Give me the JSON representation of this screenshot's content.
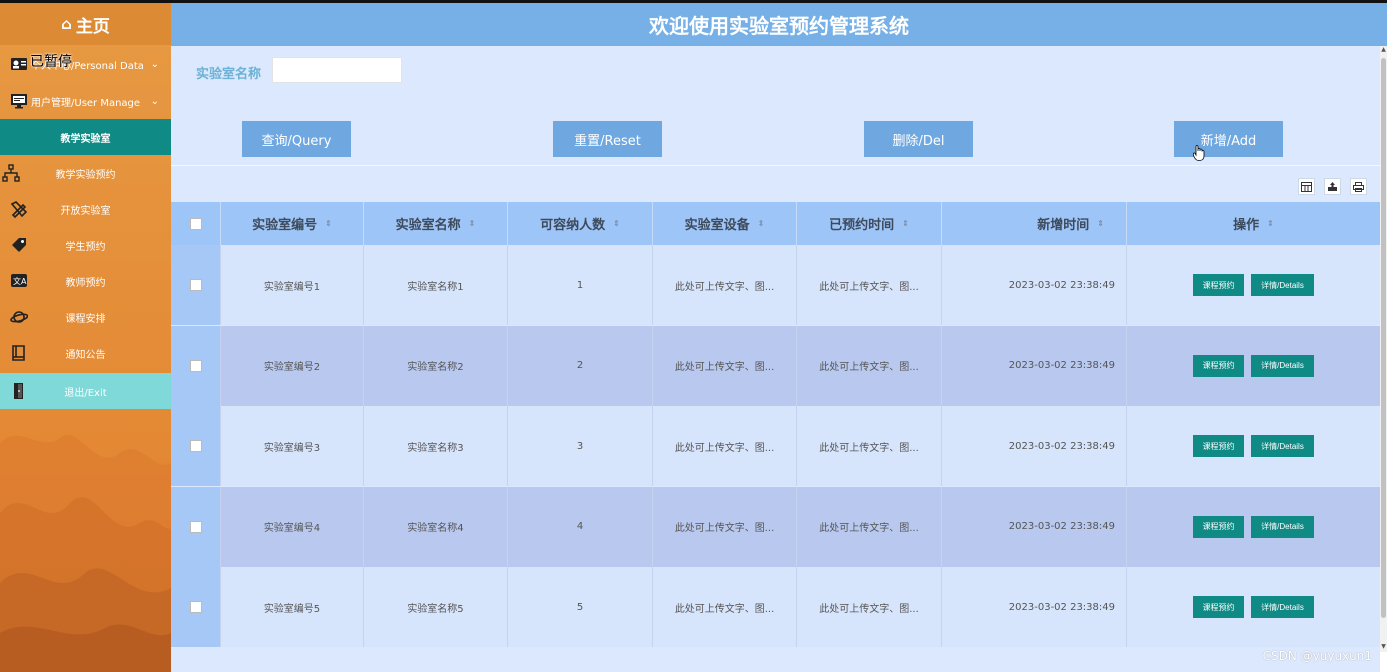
{
  "sidebar": {
    "home_label": "主页",
    "paused_overlay": "已暂停",
    "items": [
      {
        "label": "个人中心/Personal Data",
        "icon": "id-card-icon",
        "has_chevron": true
      },
      {
        "label": "用户管理/User Manage",
        "icon": "monitor-icon",
        "has_chevron": true
      },
      {
        "label": "教学实验室",
        "icon": "",
        "active": true
      },
      {
        "label": "教学实验预约",
        "icon": "sitemap-icon"
      },
      {
        "label": "开放实验室",
        "icon": "pencil-ruler-icon"
      },
      {
        "label": "学生预约",
        "icon": "tag-icon"
      },
      {
        "label": "教师预约",
        "icon": "translate-icon"
      },
      {
        "label": "课程安排",
        "icon": "planet-icon"
      },
      {
        "label": "通知公告",
        "icon": "book-icon"
      },
      {
        "label": "退出/Exit",
        "icon": "door-icon"
      }
    ]
  },
  "header": {
    "title": "欢迎使用实验室预约管理系统"
  },
  "search": {
    "label": "实验室名称",
    "value": ""
  },
  "buttons": {
    "query": "查询/Query",
    "reset": "重置/Reset",
    "delete": "删除/Del",
    "add": "新增/Add"
  },
  "table": {
    "columns": [
      "实验室编号",
      "实验室名称",
      "可容纳人数",
      "实验室设备",
      "已预约时间",
      "新增时间",
      "操作"
    ],
    "rows": [
      {
        "code": "实验室编号1",
        "name": "实验室名称1",
        "capacity": "1",
        "equipment": "此处可上传文字、图...",
        "booked": "此处可上传文字、图...",
        "added": "2023-03-02 23:38:49"
      },
      {
        "code": "实验室编号2",
        "name": "实验室名称2",
        "capacity": "2",
        "equipment": "此处可上传文字、图...",
        "booked": "此处可上传文字、图...",
        "added": "2023-03-02 23:38:49"
      },
      {
        "code": "实验室编号3",
        "name": "实验室名称3",
        "capacity": "3",
        "equipment": "此处可上传文字、图...",
        "booked": "此处可上传文字、图...",
        "added": "2023-03-02 23:38:49"
      },
      {
        "code": "实验室编号4",
        "name": "实验室名称4",
        "capacity": "4",
        "equipment": "此处可上传文字、图...",
        "booked": "此处可上传文字、图...",
        "added": "2023-03-02 23:38:49"
      },
      {
        "code": "实验室编号5",
        "name": "实验室名称5",
        "capacity": "5",
        "equipment": "此处可上传文字、图...",
        "booked": "此处可上传文字、图...",
        "added": "2023-03-02 23:38:49"
      }
    ],
    "row_actions": {
      "book": "课程预约",
      "details": "详情/Details"
    }
  },
  "watermark": "CSDN @yuyuxun1",
  "colors": {
    "sidebar_bg": "#e58f3a",
    "active_item": "#0f8a85",
    "exit_item": "#7fd9d9",
    "header_bg": "#76b0e6",
    "button_bg": "#6fa8e1",
    "row_light": "#d7e5fc",
    "row_dark": "#b8c8ee",
    "action_button": "#0f8a85"
  }
}
